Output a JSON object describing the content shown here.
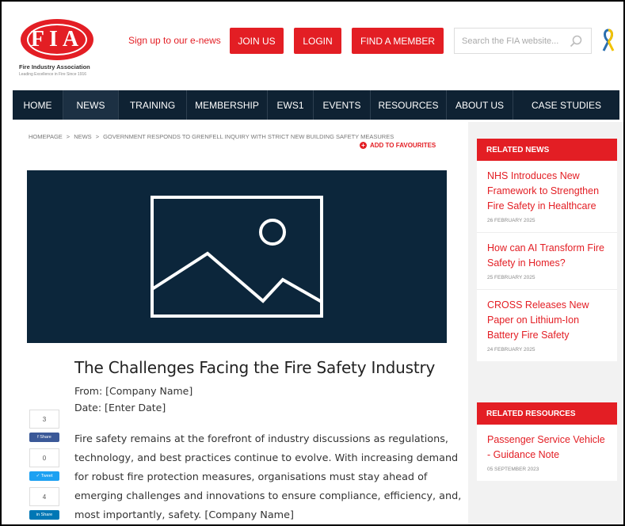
{
  "header": {
    "logo": {
      "letters": "FIA",
      "name": "Fire Industry Association",
      "tagline": "Leading Excellence in Fire Since 1916"
    },
    "signup_text": "Sign up to our e-news",
    "buttons": {
      "join": "JOIN US",
      "login": "LOGIN",
      "find": "FIND A MEMBER"
    },
    "search": {
      "placeholder": "Search the FIA website...",
      "icon": "search-icon"
    }
  },
  "nav": {
    "items": [
      "HOME",
      "NEWS",
      "TRAINING",
      "MEMBERSHIP",
      "EWS1",
      "EVENTS",
      "RESOURCES",
      "ABOUT US",
      "CASE STUDIES"
    ],
    "active": "NEWS"
  },
  "breadcrumb": {
    "items": [
      "HOMEPAGE",
      "NEWS",
      "GOVERNMENT RESPONDS TO GRENFELL INQUIRY WITH STRICT NEW BUILDING SAFETY MEASURES"
    ],
    "separator": ">"
  },
  "favourites_label": "ADD TO FAVOURITES",
  "hero": {
    "icon": "image-placeholder-icon"
  },
  "share": {
    "facebook": {
      "count": "3",
      "label": "Share"
    },
    "twitter": {
      "count": "0",
      "label": "Tweet"
    },
    "linkedin": {
      "count": "4",
      "label": "Share"
    }
  },
  "article": {
    "title": "The Challenges Facing the Fire Safety Industry",
    "from": "From: [Company Name]",
    "date": "Date: [Enter Date]",
    "body": "Fire safety remains at the forefront of industry discussions as regulations, technology, and best practices continue to evolve. With increasing demand for robust fire protection measures, organisations must stay ahead of emerging challenges and innovations to ensure compliance, efficiency, and, most importantly, safety. [Company Name]"
  },
  "sidebar": {
    "related_news": {
      "heading": "RELATED NEWS",
      "items": [
        {
          "title": "NHS Introduces New Framework to Strengthen Fire Safety in Healthcare",
          "date": "26 FEBRUARY 2025"
        },
        {
          "title": "How can AI Transform Fire Safety in Homes?",
          "date": "25 FEBRUARY 2025"
        },
        {
          "title": "CROSS Releases New Paper on Lithium-Ion Battery Fire Safety",
          "date": "24 FEBRUARY 2025"
        }
      ]
    },
    "related_resources": {
      "heading": "RELATED RESOURCES",
      "items": [
        {
          "title": "Passenger Service Vehicle - Guidance Note",
          "date": "05 SEPTEMBER 2023"
        }
      ]
    }
  },
  "colors": {
    "brand_red": "#e31e24",
    "nav_bg": "#0f2233",
    "hero_bg": "#0c263b"
  }
}
